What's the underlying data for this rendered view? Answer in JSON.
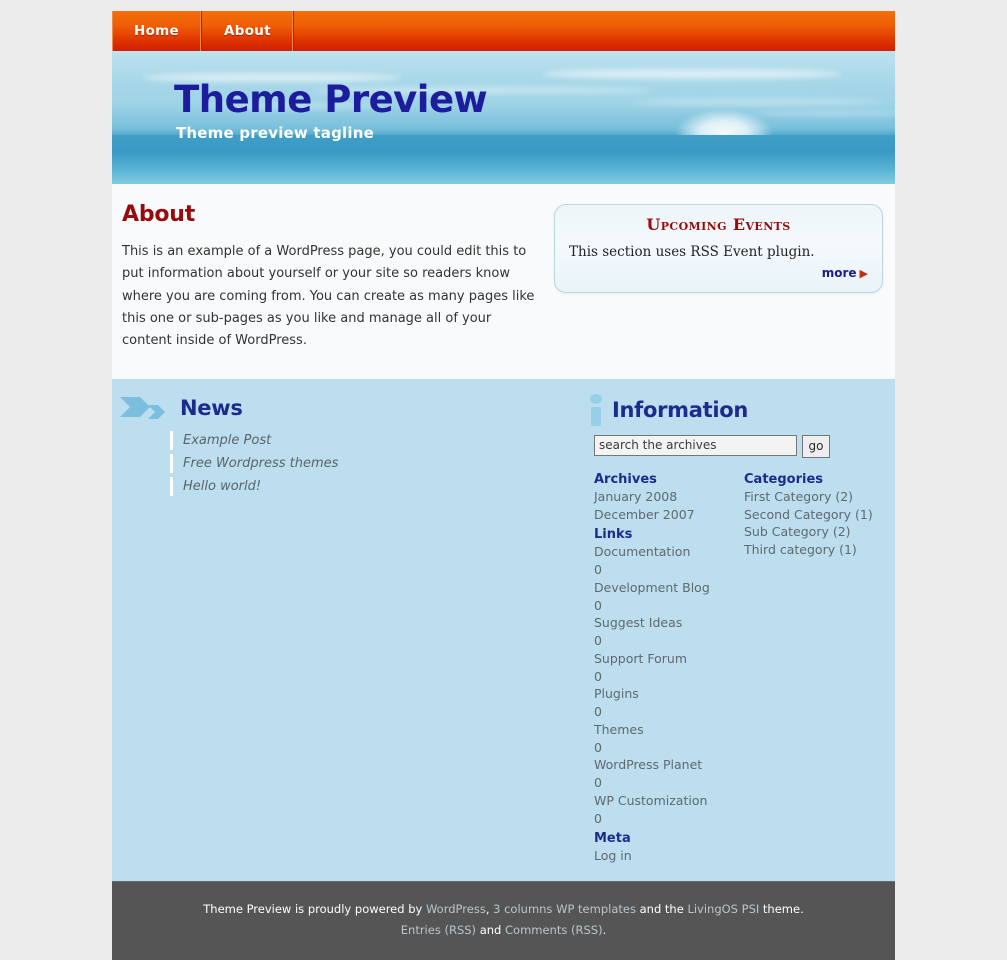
{
  "nav": {
    "items": [
      {
        "label": "Home",
        "name": "nav-item-home"
      },
      {
        "label": "About",
        "name": "nav-item-about"
      }
    ]
  },
  "banner": {
    "title": "Theme Preview",
    "tagline": "Theme preview tagline"
  },
  "content": {
    "title": "About",
    "body": "This is an example of a WordPress page, you could edit this to put information about yourself or your site so readers know where you are coming from. You can create as many pages like this one or sub-pages as you like and manage all of your content inside of WordPress."
  },
  "events": {
    "title": "Upcoming Events",
    "body": "This section uses RSS Event plugin.",
    "more_label": "more",
    "more_arrow": "▶"
  },
  "news": {
    "title": "News",
    "items": [
      "Example Post",
      "Free Wordpress themes",
      "Hello world!"
    ]
  },
  "information": {
    "title": "Information",
    "search": {
      "value": "search the archives",
      "placeholder": "search the archives",
      "button_label": "go"
    },
    "archives": {
      "title": "Archives",
      "items": [
        "January 2008",
        "December 2007"
      ]
    },
    "links": {
      "title": "Links",
      "items": [
        "Documentation",
        "0",
        "Development Blog",
        "0",
        "Suggest Ideas",
        "0",
        "Support Forum",
        "0",
        "Plugins",
        "0",
        "Themes",
        "0",
        "WordPress Planet",
        "0",
        "WP Customization",
        "0"
      ]
    },
    "meta": {
      "title": "Meta",
      "items": [
        "Log in"
      ]
    },
    "categories": {
      "title": "Categories",
      "items": [
        "First Category (2)",
        "Second Category (1)",
        "Sub Category (2)",
        "Third category (1)"
      ]
    }
  },
  "footer": {
    "line1_pre": "Theme Preview is proudly powered by ",
    "link_wordpress": "WordPress",
    "line1_mid1": ", ",
    "link_templates": "3 columns WP templates",
    "line1_mid2": " and the ",
    "link_theme": "LivingOS PSI",
    "line1_post": " theme.",
    "link_entries": "Entries (RSS)",
    "line2_mid": " and ",
    "link_comments": "Comments (RSS)",
    "line2_post": "."
  },
  "colors": {
    "nav_top": "#f4700c",
    "nav_bottom": "#cf1f00",
    "title_blue": "#1c1c9c",
    "heading_red": "#9b0a0a",
    "band_blue": "#bcdeef",
    "footer_gray": "#555555"
  }
}
